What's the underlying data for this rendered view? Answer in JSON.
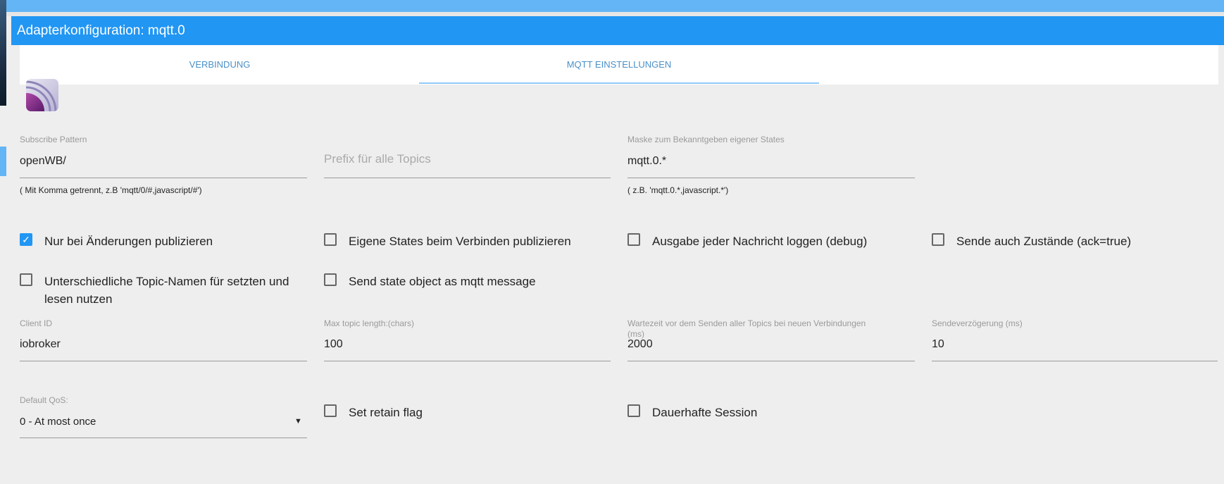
{
  "window": {
    "title": "Adapterkonfiguration: mqtt.0"
  },
  "tabs": [
    {
      "label": "VERBINDUNG",
      "active": false
    },
    {
      "label": "MQTT EINSTELLUNGEN",
      "active": true
    }
  ],
  "logo": {
    "icon": "mqtt-logo-icon"
  },
  "fields": {
    "subscribe": {
      "label": "Subscribe Pattern",
      "value": "openWB/",
      "help": "( Mit Komma getrennt, z.B 'mqtt/0/#,javascript/#')"
    },
    "prefix": {
      "placeholder": "Prefix für alle Topics"
    },
    "mask": {
      "label": "Maske zum Bekanntgeben eigener States",
      "value": "mqtt.0.*",
      "help": "( z.B. 'mqtt.0.*,javascript.*')"
    },
    "client_id": {
      "label": "Client ID",
      "value": "iobroker"
    },
    "max_topic": {
      "label": "Max topic length:(chars)",
      "value": "100"
    },
    "wait": {
      "label": "Wartezeit vor dem Senden aller Topics bei neuen Verbindungen",
      "label2": "(ms)",
      "value": "2000"
    },
    "delay": {
      "label": "Sendeverzögerung (ms)",
      "value": "10"
    },
    "qos": {
      "label": "Default QoS:",
      "value": "0 - At most once"
    }
  },
  "checkboxes": {
    "only_changes": {
      "label": "Nur bei Änderungen publizieren",
      "checked": true
    },
    "publish_own": {
      "label": "Eigene States beim Verbinden publizieren",
      "checked": false
    },
    "debug": {
      "label": "Ausgabe jeder Nachricht loggen (debug)",
      "checked": false
    },
    "send_ack": {
      "label": "Sende auch Zustände (ack=true)",
      "checked": false
    },
    "different_topics": {
      "label": "Unterschiedliche Topic-Namen für setzten und lesen nutzen",
      "checked": false
    },
    "state_object": {
      "label": "Send state object as mqtt message",
      "checked": false
    },
    "retain": {
      "label": "Set retain flag",
      "checked": false
    },
    "persistent": {
      "label": "Dauerhafte Session",
      "checked": false
    }
  },
  "colors": {
    "accent": "#2196f3",
    "topbar": "#64b5f6",
    "background": "#eeeeee"
  }
}
